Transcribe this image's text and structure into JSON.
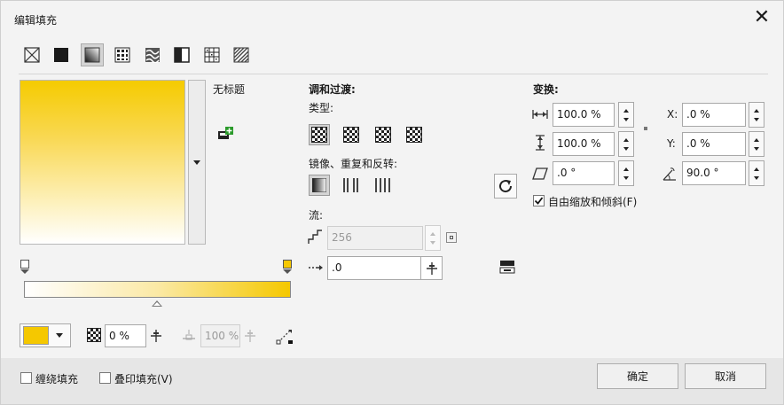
{
  "window": {
    "title": "编辑填充"
  },
  "fill_types": [
    {
      "name": "no-fill"
    },
    {
      "name": "uniform-fill"
    },
    {
      "name": "fountain-fill"
    },
    {
      "name": "vector-pattern"
    },
    {
      "name": "bitmap-pattern"
    },
    {
      "name": "two-color-pattern"
    },
    {
      "name": "texture-fill"
    },
    {
      "name": "postscript-fill"
    }
  ],
  "preset": {
    "name": "无标题"
  },
  "color": {
    "stop_color": "#f5c800",
    "start_color": "#ffffff"
  },
  "opacity": {
    "value": "0 %"
  },
  "node_position": {
    "value": "100 %"
  },
  "blend": {
    "heading": "调和过渡:",
    "type_label": "类型:",
    "mirror_label": "镜像、重复和反转:",
    "flow_label": "流:",
    "steps_value": "256",
    "acceleration_value": ".0"
  },
  "transform": {
    "heading": "变换:",
    "width_value": "100.0 %",
    "height_value": "100.0 %",
    "skew_value": ".0 °",
    "x_label": "X:",
    "x_value": ".0 %",
    "y_label": "Y:",
    "y_value": ".0 %",
    "rotate_value": "90.0 °",
    "free_scale_label": "自由缩放和倾斜(F)",
    "free_scale_checked": true
  },
  "footer": {
    "wrap_fill_label": "缠绕填充",
    "overprint_label": "叠印填充(V)",
    "ok_label": "确定",
    "cancel_label": "取消"
  }
}
